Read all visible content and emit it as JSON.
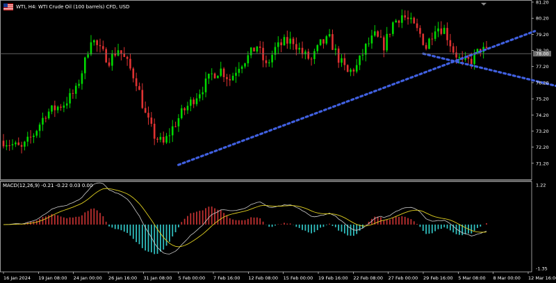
{
  "header": {
    "symbol_title": "WTI, H4:  WTI Crude Oil (100 barrels) CFD, USD",
    "macd_label": "MACD(12,26,9) -0.21 -0.22 0.03 0.00"
  },
  "icons": {
    "flag": "flag-icon",
    "dropdown": "dropdown-triangle-icon"
  },
  "colors": {
    "background": "#000000",
    "bull": "#00d800",
    "bear": "#e03232",
    "trendline": "#4060e0",
    "price_line": "#707070",
    "macd_pos": "#c03030",
    "macd_neg": "#30c0c0",
    "macd_line": "#d0d0d0",
    "signal_line": "#e0d020",
    "text": "#ffffff",
    "current_price_bg": "#707070"
  },
  "chart_data": {
    "type": "candlestick",
    "timeframe": "H4",
    "instrument": "WTI",
    "price_axis": {
      "ticks": [
        "81.20",
        "80.20",
        "79.20",
        "78.20",
        "77.20",
        "76.20",
        "75.20",
        "74.20",
        "73.20",
        "72.20",
        "71.20"
      ],
      "range": [
        70.2,
        81.2
      ],
      "current_price": "78.00"
    },
    "time_axis": {
      "labels": [
        "16 Jan 2024",
        "19 Jan 08:00",
        "24 Jan 00:00",
        "26 Jan 16:00",
        "31 Jan 08:00",
        "5 Feb 00:00",
        "7 Feb 16:00",
        "12 Feb 08:00",
        "15 Feb 00:00",
        "19 Feb 16:00",
        "22 Feb 08:00",
        "27 Feb 00:00",
        "29 Feb 16:00",
        "5 Mar 08:00",
        "8 Mar 00:00",
        "12 Mar 16:00"
      ]
    },
    "close_path": [
      [
        0,
        72.6
      ],
      [
        6,
        72.1
      ],
      [
        10,
        73.0
      ],
      [
        14,
        74.3
      ],
      [
        20,
        74.9
      ],
      [
        24,
        75.7
      ],
      [
        27,
        77.5
      ],
      [
        29,
        79.0
      ],
      [
        32,
        78.2
      ],
      [
        35,
        77.6
      ],
      [
        38,
        78.3
      ],
      [
        41,
        77.4
      ],
      [
        44,
        76.3
      ],
      [
        47,
        74.2
      ],
      [
        50,
        72.9
      ],
      [
        53,
        72.4
      ],
      [
        56,
        73.4
      ],
      [
        59,
        74.3
      ],
      [
        63,
        75.2
      ],
      [
        66,
        75.9
      ],
      [
        69,
        76.7
      ],
      [
        72,
        77.0
      ],
      [
        75,
        76.4
      ],
      [
        78,
        77.3
      ],
      [
        81,
        77.8
      ],
      [
        84,
        78.5
      ],
      [
        87,
        77.2
      ],
      [
        90,
        78.3
      ],
      [
        93,
        78.7
      ],
      [
        96,
        78.8
      ],
      [
        99,
        78.0
      ],
      [
        102,
        77.6
      ],
      [
        105,
        78.6
      ],
      [
        108,
        78.9
      ],
      [
        111,
        77.7
      ],
      [
        114,
        76.8
      ],
      [
        117,
        77.2
      ],
      [
        120,
        78.4
      ],
      [
        123,
        79.1
      ],
      [
        126,
        78.5
      ],
      [
        129,
        79.9
      ],
      [
        132,
        80.4
      ],
      [
        135,
        79.9
      ],
      [
        138,
        79.2
      ],
      [
        140,
        78.4
      ],
      [
        143,
        79.7
      ],
      [
        146,
        79.5
      ],
      [
        149,
        78.2
      ],
      [
        152,
        77.4
      ],
      [
        155,
        77.6
      ],
      [
        158,
        78.3
      ],
      [
        160,
        78.1
      ]
    ],
    "indicator": {
      "name": "MACD",
      "params": [
        12,
        26,
        9
      ],
      "values": [
        -0.21,
        -0.22,
        0.03,
        0.0
      ],
      "axis_ticks": [
        "1.22",
        "-1.35"
      ],
      "range": [
        -1.35,
        1.22
      ]
    },
    "trendlines": [
      {
        "from": [
          "5 Feb 00:00",
          71.1
        ],
        "to": [
          "8 Mar 00:00",
          79.4
        ],
        "style": "dotted"
      },
      {
        "from": [
          "29 Feb 16:00",
          78.0
        ],
        "to": [
          "12 Mar 16:00",
          76.0
        ],
        "style": "dotted"
      }
    ]
  }
}
